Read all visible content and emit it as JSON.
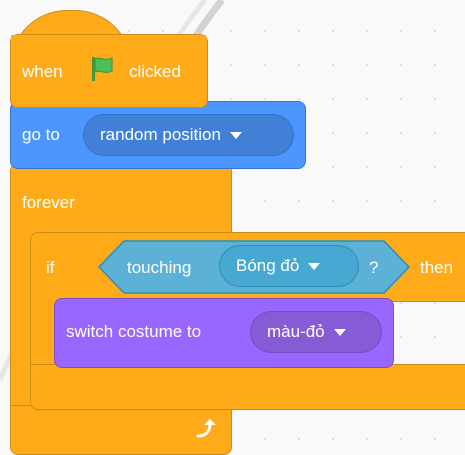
{
  "hat_block": {
    "label_when": "when",
    "icon": "green-flag-icon",
    "label_clicked": "clicked"
  },
  "goto_block": {
    "label": "go to",
    "dropdown_value": "random position"
  },
  "forever_block": {
    "label": "forever",
    "loop_arrow_icon": "loop-arrow-icon"
  },
  "if_block": {
    "label_if": "if",
    "label_then": "then",
    "condition": {
      "label": "touching",
      "dropdown_value": "Bóng đỏ",
      "question": "?"
    }
  },
  "costume_block": {
    "label": "switch costume to",
    "dropdown_value": "màu-đỏ"
  },
  "colors": {
    "events": "#ffab19",
    "control": "#ffab19",
    "motion": "#4c97ff",
    "sensing": "#5cb1d6",
    "looks": "#9966ff",
    "flag": "#4cbf56"
  }
}
